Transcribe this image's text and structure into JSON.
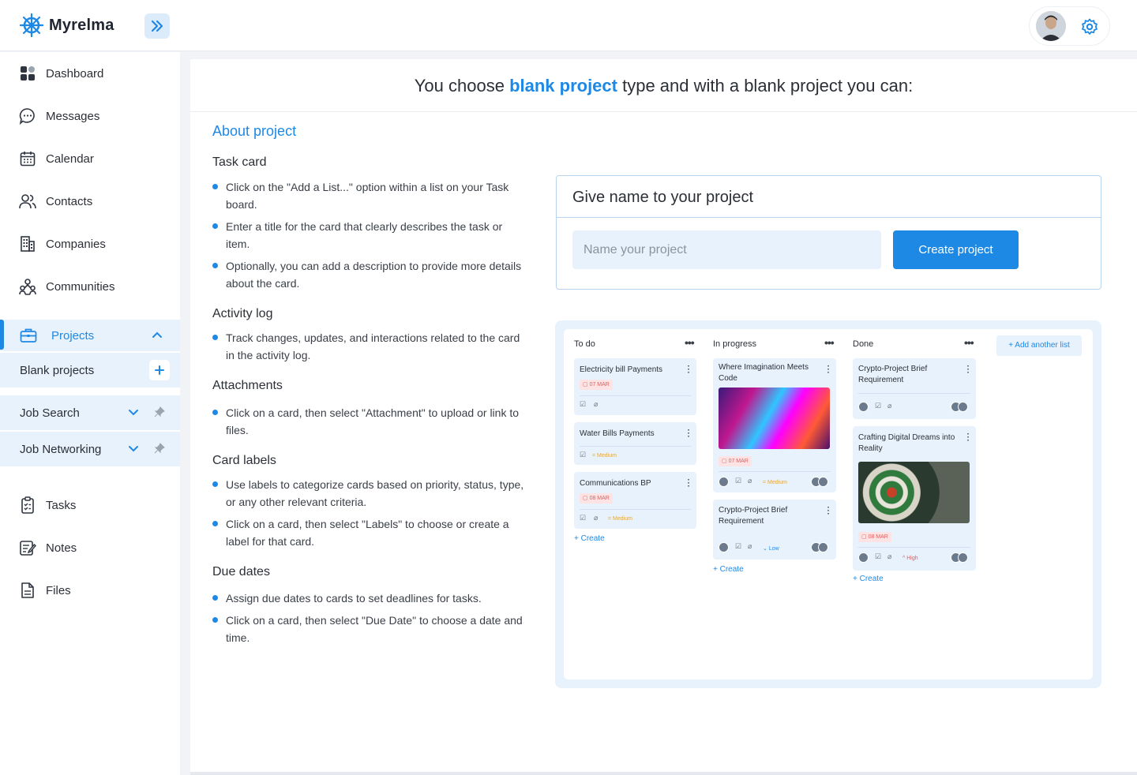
{
  "app": {
    "name": "Myrelma"
  },
  "sidebar": {
    "items": [
      {
        "label": "Dashboard",
        "icon": "dashboard-icon"
      },
      {
        "label": "Messages",
        "icon": "chat-bubble-icon"
      },
      {
        "label": "Calendar",
        "icon": "calendar-icon"
      },
      {
        "label": "Contacts",
        "icon": "contacts-icon"
      },
      {
        "label": "Companies",
        "icon": "building-icon"
      },
      {
        "label": "Communities",
        "icon": "communities-icon"
      }
    ],
    "projects": {
      "label": "Projects",
      "icon": "briefcase-icon"
    },
    "sub": [
      {
        "label": "Blank projects"
      },
      {
        "label": "Job Search"
      },
      {
        "label": "Job Networking"
      }
    ],
    "bottom": [
      {
        "label": "Tasks",
        "icon": "clipboard-icon"
      },
      {
        "label": "Notes",
        "icon": "notes-icon"
      },
      {
        "label": "Files",
        "icon": "file-icon"
      }
    ]
  },
  "main": {
    "title_pre": "You choose ",
    "title_hl": "blank project",
    "title_post": " type and with a blank project you can:",
    "about": "About project",
    "sections": [
      {
        "heading": "Task card",
        "bullets": [
          "Click on the \"Add a List...\" option within a list on your Task board.",
          "Enter a title for the card that clearly describes the task or item.",
          "Optionally, you can add a description to provide more details about the card."
        ]
      },
      {
        "heading": "Activity log",
        "bullets": [
          "Track changes, updates, and interactions related to the card in the activity log."
        ]
      },
      {
        "heading": "Attachments",
        "bullets": [
          "Click on a card, then select \"Attachment\" to upload or link to files."
        ]
      },
      {
        "heading": "Card labels",
        "bullets": [
          "Use labels to categorize cards based on priority, status, type, or any other relevant criteria.",
          "Click on a card, then select \"Labels\" to choose or create a label for that card."
        ]
      },
      {
        "heading": "Due dates",
        "bullets": [
          "Assign due dates to cards to set deadlines for tasks.",
          "Click on a card, then select \"Due Date\" to choose a date and time."
        ]
      }
    ],
    "form": {
      "title": "Give name to your project",
      "placeholder": "Name your project",
      "button": "Create project"
    },
    "board": {
      "columns": [
        {
          "title": "To do",
          "create": "Create",
          "cards": [
            {
              "title": "Electricity bill Payments",
              "date": "07 MAR"
            },
            {
              "title": "Water Bills Payments",
              "priority": "Medium"
            },
            {
              "title": "Communications BP",
              "date": "08 MAR",
              "priority": "Medium"
            }
          ]
        },
        {
          "title": "In progress",
          "create": "Create",
          "cards": [
            {
              "title": "Where Imagination Meets Code",
              "date": "07 MAR",
              "priority": "Medium"
            },
            {
              "title": "Crypto-Project Brief Requirement",
              "priority": "Low"
            }
          ]
        },
        {
          "title": "Done",
          "create": "Create",
          "cards": [
            {
              "title": "Crypto-Project Brief Requirement"
            },
            {
              "title": "Crafting Digital Dreams into Reality",
              "date": "08 MAR",
              "priority": "High"
            }
          ]
        }
      ],
      "add_list": "+ Add another list"
    }
  },
  "colors": {
    "accent": "#1e88e5",
    "accent_light": "#e8f2fc",
    "danger": "#e35d5d",
    "medium": "#e5a83a"
  }
}
